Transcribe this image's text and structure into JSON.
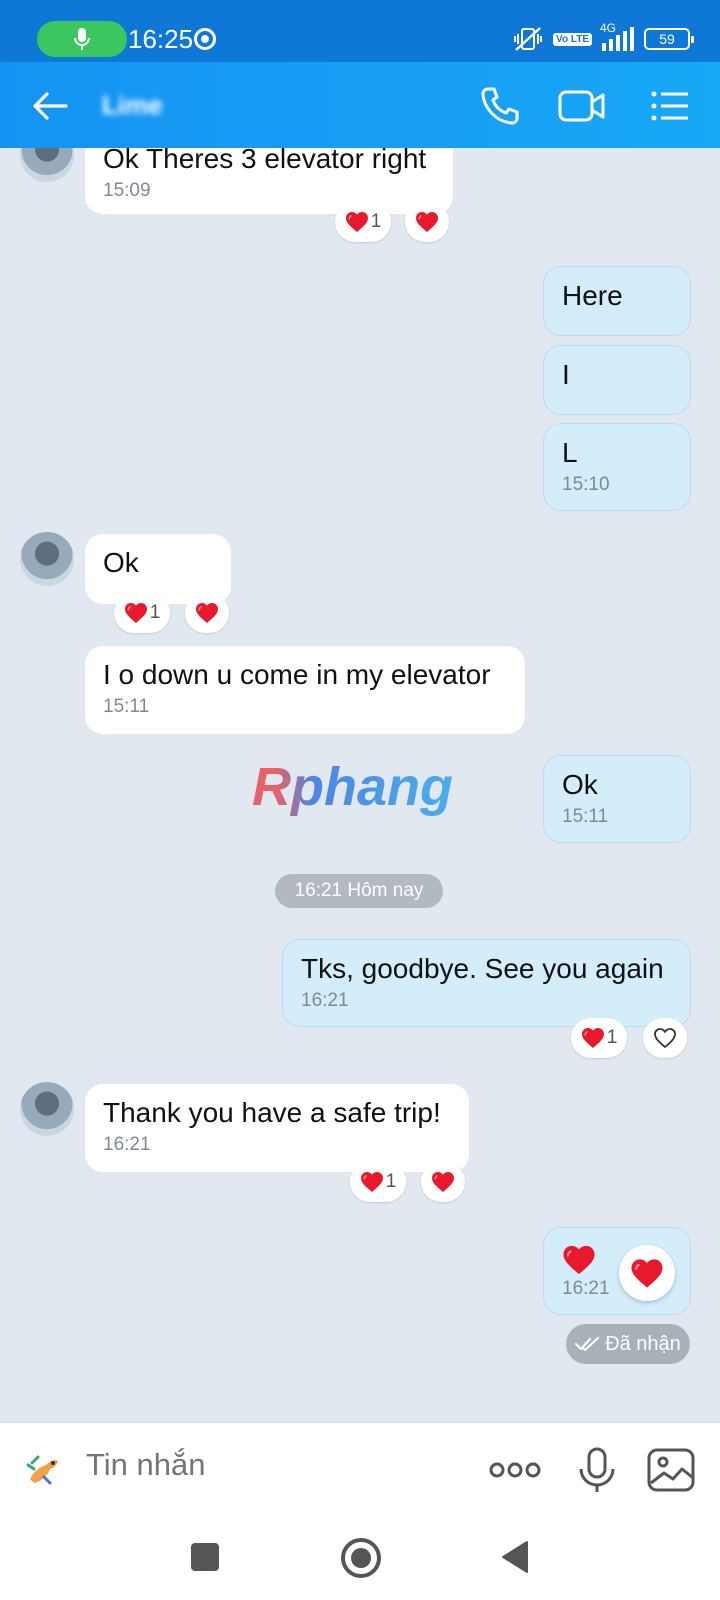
{
  "status_bar": {
    "time": "16:25",
    "network": "4G",
    "battery": "59",
    "volte": "Vo LTE"
  },
  "header": {
    "contact_name": "Lime"
  },
  "messages": [
    {
      "side": "in",
      "text": "Ok Theres 3 elevator right",
      "time": "15:09",
      "reaction_count": "1"
    },
    {
      "side": "out",
      "text": "Here"
    },
    {
      "side": "out",
      "text": "I"
    },
    {
      "side": "out",
      "text": "L",
      "time": "15:10"
    },
    {
      "side": "in",
      "text": "Ok",
      "reaction_count": "1"
    },
    {
      "side": "in",
      "text": "I o down u come in my elevator",
      "time": "15:11"
    },
    {
      "side": "out",
      "text": "Ok",
      "time": "15:11"
    },
    {
      "side": "out",
      "text": "Tks, goodbye. See you again",
      "time": "16:21",
      "reaction_count": "1"
    },
    {
      "side": "in",
      "text": "Thank you have a safe trip!",
      "time": "16:21",
      "reaction_count": "1"
    },
    {
      "side": "out",
      "text": "❤️",
      "time": "16:21"
    }
  ],
  "date_divider": "16:21 Hôm nay",
  "watermark": "Rphang",
  "received_status": "Đã nhận",
  "input": {
    "placeholder": "Tin nhắn"
  },
  "colors": {
    "header": "#1593f2",
    "bubble_out": "#d4edfb",
    "bubble_in": "#ffffff",
    "heart": "#e8192c",
    "background": "#e2e8f0"
  }
}
